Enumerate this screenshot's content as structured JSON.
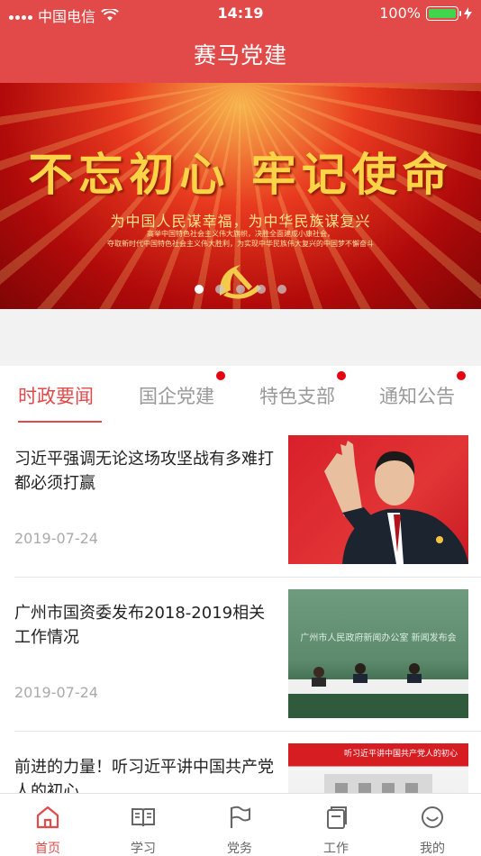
{
  "status_bar": {
    "carrier": "中国电信",
    "time": "14:19",
    "battery": "100%",
    "battery_level": 100
  },
  "header": {
    "title": "赛马党建"
  },
  "banner": {
    "slogan": "不忘初心 牢记使命",
    "subtitle": "为中国人民谋幸福，为中华民族谋复兴",
    "small_line_1": "高举中国特色社会主义伟大旗帜，决胜全面建成小康社会，",
    "small_line_2": "夺取新时代中国特色社会主义伟大胜利，为实现中华民族伟大复兴的中国梦不懈奋斗",
    "page_count": 5,
    "current_page": 1
  },
  "tabs": [
    {
      "label": "时政要闻",
      "active": true,
      "badge": false
    },
    {
      "label": "国企党建",
      "active": false,
      "badge": true
    },
    {
      "label": "特色支部",
      "active": false,
      "badge": true
    },
    {
      "label": "通知公告",
      "active": false,
      "badge": true
    }
  ],
  "news": [
    {
      "title": "习近平强调无论这场攻坚战有多难打都必须打赢",
      "date": "2019-07-24"
    },
    {
      "title": "广州市国资委发布2018-2019相关工作情况",
      "date": "2019-07-24",
      "image_text": "广州市人民政府新闻办公室 新闻发布会"
    },
    {
      "title": "前进的力量！听习近平讲中国共产党人的初心",
      "date": "",
      "image_text": "听习近平讲中国共产党人的初心"
    }
  ],
  "tabbar": [
    {
      "label": "首页",
      "icon": "home-icon",
      "active": true
    },
    {
      "label": "学习",
      "icon": "book-icon",
      "active": false
    },
    {
      "label": "党务",
      "icon": "flag-icon",
      "active": false
    },
    {
      "label": "工作",
      "icon": "document-icon",
      "active": false
    },
    {
      "label": "我的",
      "icon": "smile-icon",
      "active": false
    }
  ],
  "colors": {
    "brand": "#e24a4a",
    "badge": "#e60012"
  }
}
